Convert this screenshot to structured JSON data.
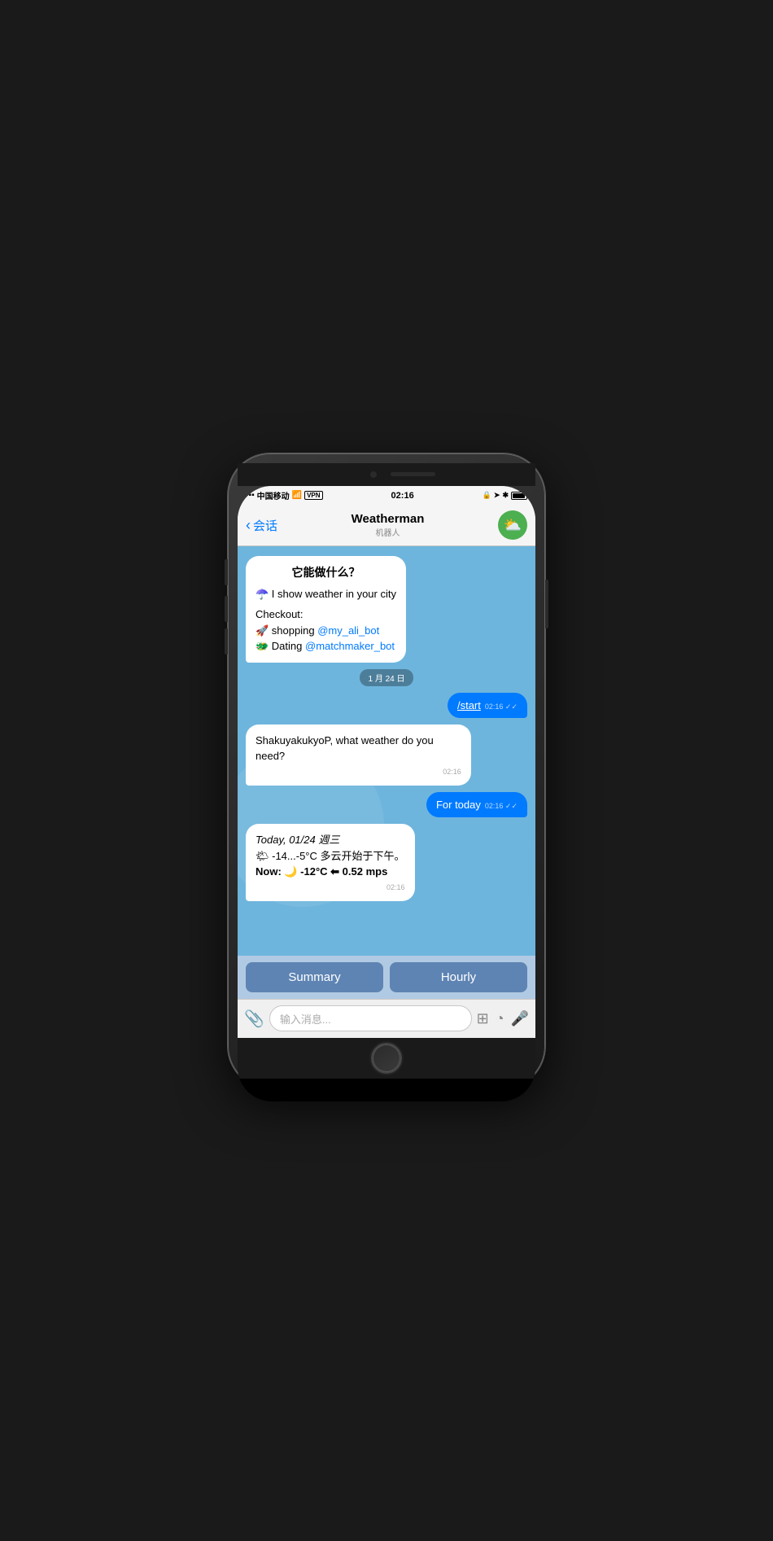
{
  "phone": {
    "status_bar": {
      "carrier": "中国移动",
      "wifi": "WiFi",
      "vpn": "VPN",
      "time": "02:16",
      "battery": "100"
    },
    "nav": {
      "back_label": "会话",
      "title": "Weatherman",
      "subtitle": "机器人",
      "avatar_icon": "☁️"
    },
    "messages": [
      {
        "type": "bot",
        "title": "它能做什么？",
        "lines": [
          "☂️ I show weather in your city",
          "",
          "Checkout:",
          "🚀 shopping @my_ali_bot",
          "🐲 Dating @matchmaker_bot"
        ],
        "links": [
          "@my_ali_bot",
          "@matchmaker_bot"
        ]
      },
      {
        "type": "date_sep",
        "text": "1 月 24 日"
      },
      {
        "type": "user",
        "text": "/start",
        "time": "02:16",
        "ticks": "✓✓"
      },
      {
        "type": "bot",
        "text": "ShakuyakukyoP, what weather do you need?",
        "time": "02:16"
      },
      {
        "type": "user",
        "text": "For today",
        "time": "02:16",
        "ticks": "✓✓"
      },
      {
        "type": "bot",
        "weather": true,
        "date_line": "Today, 01/24 週三",
        "temp_range": "🌤 -14...-5°C 多云开始于下午。",
        "now_line": "Now: 🌙 -12°C ⬅ 0.52 mps",
        "time": "02:16"
      }
    ],
    "quick_replies": {
      "btn1": "Summary",
      "btn2": "Hourly"
    },
    "input_bar": {
      "placeholder": "输入消息..."
    }
  }
}
